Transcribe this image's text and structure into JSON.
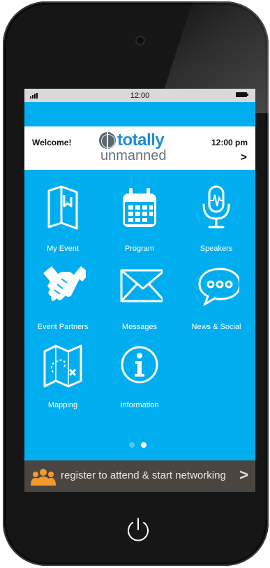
{
  "status_bar": {
    "time": "12:00"
  },
  "header": {
    "welcome": "Welcome!",
    "time": "12:00 pm",
    "chevron": ">",
    "logo": {
      "top": "totally",
      "bottom": "unmanned"
    }
  },
  "menu": [
    {
      "label": "My Event",
      "icon": "book-icon"
    },
    {
      "label": "Program",
      "icon": "calendar-icon"
    },
    {
      "label": "Speakers",
      "icon": "microphone-icon"
    },
    {
      "label": "Event Partners",
      "icon": "handshake-icon"
    },
    {
      "label": "Messages",
      "icon": "envelope-icon"
    },
    {
      "label": "News & Social",
      "icon": "speech-bubble-icon"
    },
    {
      "label": "Mapping",
      "icon": "map-icon"
    },
    {
      "label": "Information",
      "icon": "info-icon"
    }
  ],
  "pager": {
    "pages": 2,
    "active": 2
  },
  "footer": {
    "text": "register to attend & start networking",
    "arrow": ">"
  },
  "colors": {
    "screen_bg": "#00aeef",
    "footer_bg": "#4b4542",
    "accent_orange": "#f39a2b",
    "logo_blue": "#1b8fd8"
  }
}
